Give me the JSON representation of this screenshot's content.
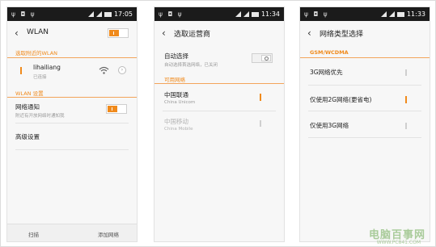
{
  "screen1": {
    "status_time": "17:05",
    "title": "WLAN",
    "section_nearby": "选取附近的WLAN",
    "network": {
      "name": "lihailiang",
      "status": "已连接"
    },
    "section_settings": "WLAN 设置",
    "notify": {
      "title": "网络通知",
      "subtitle": "附近有开放网络时通知我"
    },
    "advanced": "高级设置",
    "bottom_left": "扫描",
    "bottom_right": "添加网络"
  },
  "screen2": {
    "status_time": "11:34",
    "title": "选取运营商",
    "auto": {
      "title": "自动选择",
      "subtitle": "自动选择首选网络，已关闭"
    },
    "section_available": "可用网络",
    "carrier1": {
      "name": "中国联通",
      "sub": "China Unicom"
    },
    "carrier2": {
      "name": "中国移动",
      "sub": "China Mobile"
    }
  },
  "screen3": {
    "status_time": "11:33",
    "title": "网络类型选择",
    "section": "GSM/WCDMA",
    "options": [
      "3G网络优先",
      "仅使用2G网络(更省电)",
      "仅使用3G网络"
    ]
  },
  "watermark": {
    "main": "电脑百事网",
    "sub": "WWW.PC841.COM"
  },
  "colors": {
    "accent": "#f08a1c",
    "statusbar": "#1b1b1b"
  }
}
